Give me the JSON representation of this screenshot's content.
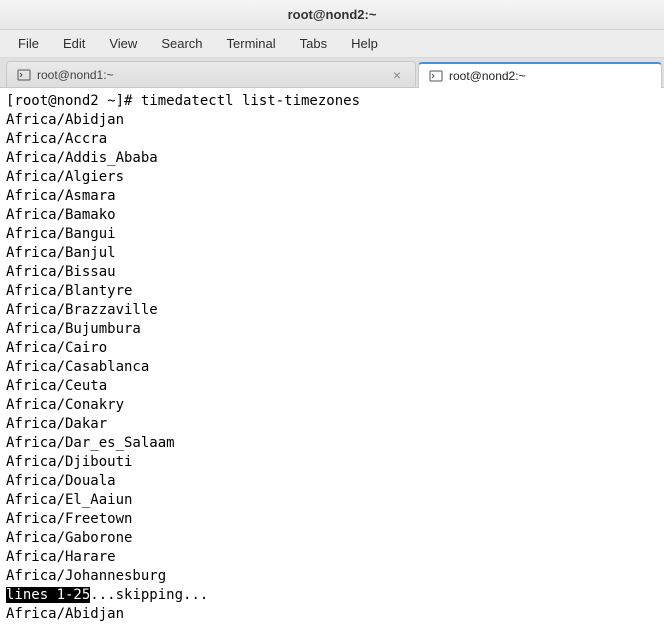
{
  "window": {
    "title": "root@nond2:~"
  },
  "menubar": {
    "items": [
      "File",
      "Edit",
      "View",
      "Search",
      "Terminal",
      "Tabs",
      "Help"
    ]
  },
  "tabs": [
    {
      "label": "root@nond1:~",
      "active": false
    },
    {
      "label": "root@nond2:~",
      "active": true
    }
  ],
  "terminal": {
    "prompt": "[root@nond2 ~]# ",
    "command": "timedatectl list-timezones",
    "output_lines": [
      "Africa/Abidjan",
      "Africa/Accra",
      "Africa/Addis_Ababa",
      "Africa/Algiers",
      "Africa/Asmara",
      "Africa/Bamako",
      "Africa/Bangui",
      "Africa/Banjul",
      "Africa/Bissau",
      "Africa/Blantyre",
      "Africa/Brazzaville",
      "Africa/Bujumbura",
      "Africa/Cairo",
      "Africa/Casablanca",
      "Africa/Ceuta",
      "Africa/Conakry",
      "Africa/Dakar",
      "Africa/Dar_es_Salaam",
      "Africa/Djibouti",
      "Africa/Douala",
      "Africa/El_Aaiun",
      "Africa/Freetown",
      "Africa/Gaborone",
      "Africa/Harare",
      "Africa/Johannesburg"
    ],
    "pager_highlight": "lines 1-25",
    "pager_rest": "...skipping...",
    "after_skip": "Africa/Abidjan"
  }
}
